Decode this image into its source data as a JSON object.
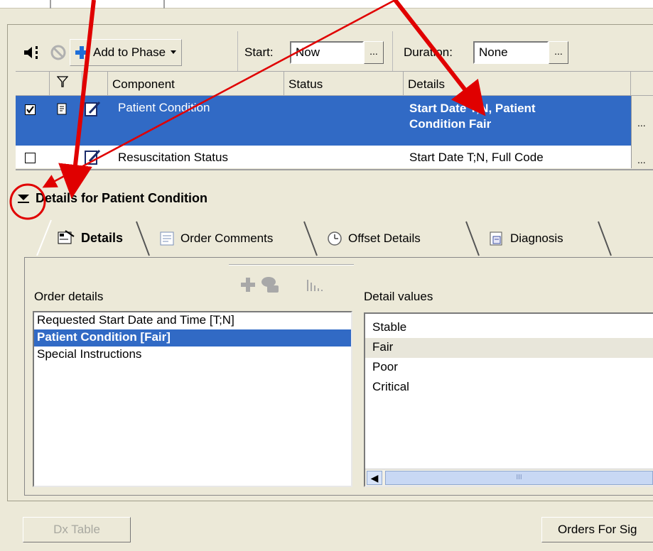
{
  "toolbar": {
    "add_to_phase_label": "Add to Phase",
    "start_label": "Start:",
    "start_value": "Now",
    "duration_label": "Duration:",
    "duration_value": "None",
    "dots": "..."
  },
  "grid": {
    "columns": [
      "Component",
      "Status",
      "Details"
    ],
    "rows": [
      {
        "checked": true,
        "component": "Patient Condition",
        "status": "",
        "details_line1": "Start Date T;N, Patient",
        "details_line2": "Condition Fair",
        "selected": true
      },
      {
        "checked": false,
        "component": "Resuscitation Status",
        "status": "",
        "details_line1": "Start Date T;N, Full Code",
        "details_line2": "",
        "selected": false
      }
    ],
    "dots": "..."
  },
  "details_panel": {
    "title": "Details for Patient Condition",
    "tabs": [
      "Details",
      "Order Comments",
      "Offset Details",
      "Diagnosis"
    ],
    "active_tab": "Details",
    "order_details_label": "Order details",
    "detail_values_label": "Detail values",
    "order_details_items": [
      "Requested Start Date and Time   [T;N]",
      "Patient Condition   [Fair]",
      "Special Instructions"
    ],
    "selected_order_detail": "Patient Condition   [Fair]",
    "detail_values_items": [
      "Stable",
      "Fair",
      "Poor",
      "Critical"
    ],
    "selected_detail_value": "Fair",
    "scrollbar_thumb_glyph": "III"
  },
  "bottom_buttons": {
    "dx_table": "Dx Table",
    "orders_for_sig": "Orders For Sig"
  },
  "colors": {
    "selection_blue": "#316ac5",
    "window_bg": "#ece9d8",
    "annotation_red": "#e00000",
    "plus_blue": "#1e6fd9"
  }
}
